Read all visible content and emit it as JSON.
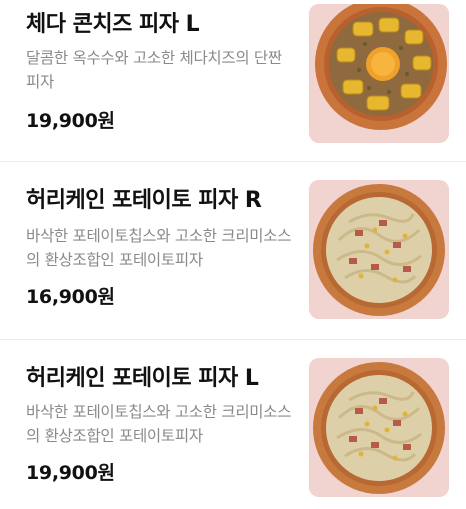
{
  "menu": {
    "items": [
      {
        "name": "체다 콘치즈 피자 L",
        "description": "달콤한 옥수수와 고소한 체다치즈의 단짠 피자",
        "price": "19,900원",
        "image": "cheddar-corn-pizza-image"
      },
      {
        "name": "허리케인 포테이토 피자 R",
        "description": "바삭한 포테이토칩스와 고소한 크리미소스의 환상조합인 포테이토피자",
        "price": "16,900원",
        "image": "potato-pizza-image"
      },
      {
        "name": "허리케인 포테이토 피자 L",
        "description": "바삭한 포테이토칩스와 고소한 크리미소스의 환상조합인 포테이토피자",
        "price": "19,900원",
        "image": "potato-pizza-image"
      }
    ]
  },
  "colors": {
    "text_primary": "#111111",
    "text_secondary": "#8a8a8a",
    "thumb_background": "#f1d3cf",
    "divider": "#ececec"
  }
}
